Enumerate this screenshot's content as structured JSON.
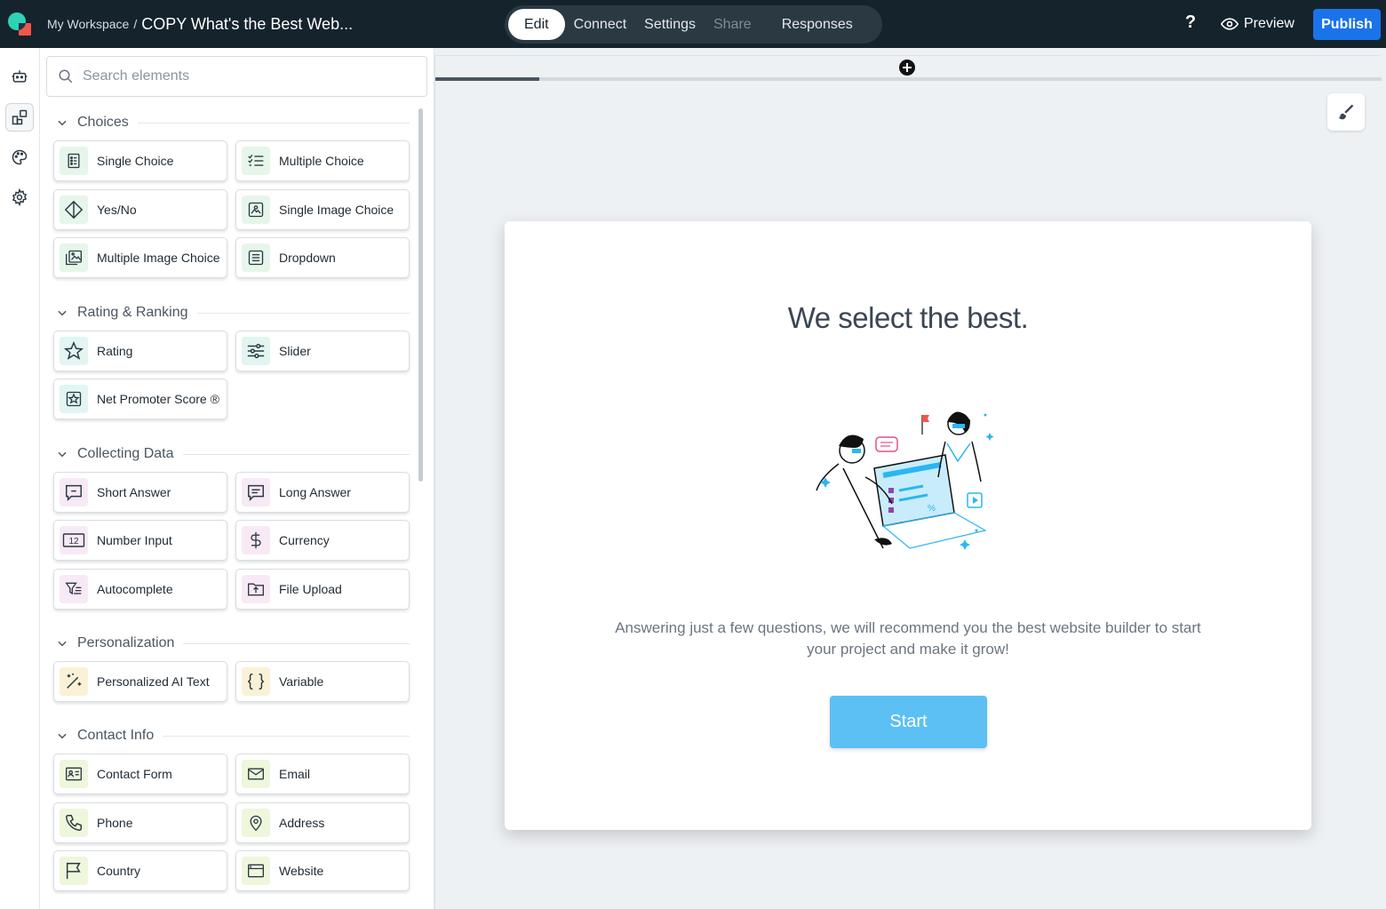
{
  "header": {
    "workspace": "My Workspace",
    "separator": "/",
    "form_title": "COPY What's the Best Web...",
    "tabs": [
      "Edit",
      "Connect",
      "Settings",
      "Share",
      "Responses"
    ],
    "help_label": "?",
    "preview_label": "Preview",
    "publish_label": "Publish"
  },
  "colors": {
    "topbar": "#15232c",
    "publish": "#1a73e8",
    "start_button": "#5cc0f4"
  },
  "search": {
    "placeholder": "Search elements"
  },
  "sections": {
    "choices": {
      "title": "Choices",
      "items": [
        "Single Choice",
        "Multiple Choice",
        "Yes/No",
        "Single Image Choice",
        "Multiple Image Choice",
        "Dropdown"
      ]
    },
    "rating": {
      "title": "Rating & Ranking",
      "items": [
        "Rating",
        "Slider",
        "Net Promoter Score ®"
      ]
    },
    "collecting": {
      "title": "Collecting Data",
      "items": [
        "Short Answer",
        "Long Answer",
        "Number Input",
        "Currency",
        "Autocomplete",
        "File Upload"
      ],
      "number_icon_text": "12"
    },
    "personalization": {
      "title": "Personalization",
      "items": [
        "Personalized AI Text",
        "Variable"
      ]
    },
    "contact": {
      "title": "Contact Info",
      "items": [
        "Contact Form",
        "Email",
        "Phone",
        "Address",
        "Country",
        "Website"
      ]
    }
  },
  "canvas": {
    "progress_fraction": 0.11,
    "headline": "We select the best.",
    "description": "Answering just a few questions, we will recommend you the best website builder to start your project and make it grow!",
    "start_label": "Start"
  }
}
